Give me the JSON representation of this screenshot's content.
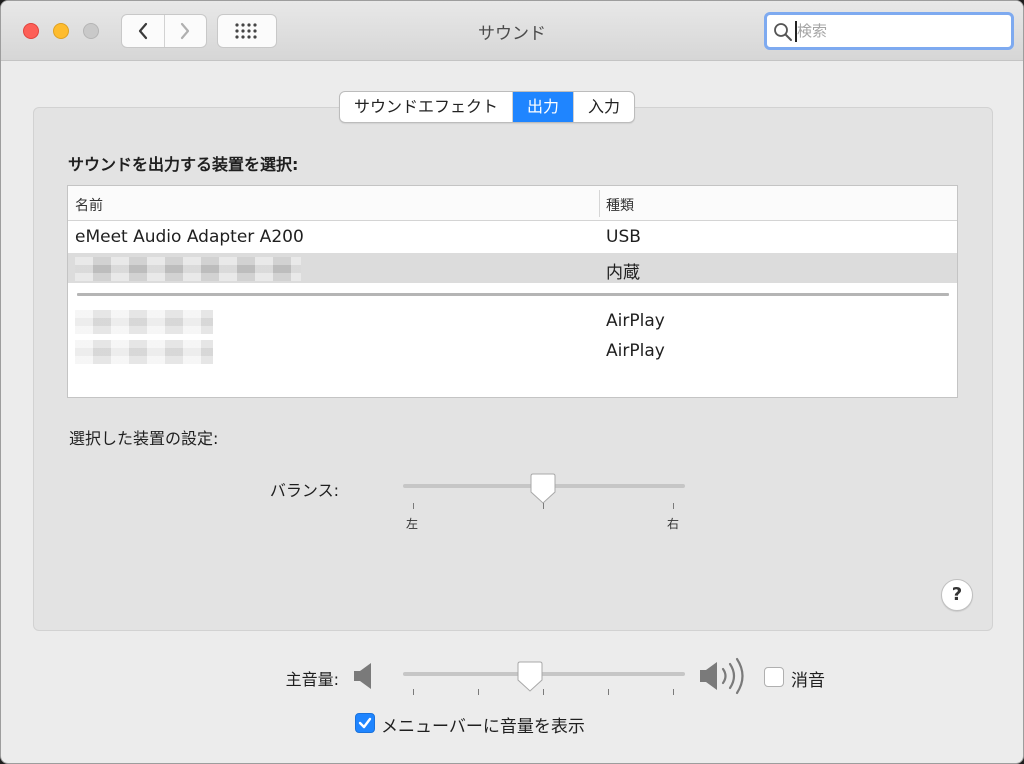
{
  "window": {
    "title": "サウンド"
  },
  "search": {
    "placeholder": "検索",
    "value": ""
  },
  "tabs": [
    {
      "label": "サウンドエフェクト",
      "active": false
    },
    {
      "label": "出力",
      "active": true
    },
    {
      "label": "入力",
      "active": false
    }
  ],
  "output": {
    "section_title": "サウンドを出力する装置を選択:",
    "columns": {
      "name": "名前",
      "type": "種類"
    },
    "devices": [
      {
        "name": "eMeet Audio Adapter A200",
        "type": "USB",
        "selected": false
      },
      {
        "name": "",
        "type": "内蔵",
        "selected": true,
        "name_redacted": true
      },
      {
        "name": "",
        "type": "AirPlay",
        "selected": false,
        "name_redacted": true
      },
      {
        "name": "",
        "type": "AirPlay",
        "selected": false,
        "name_redacted": true
      }
    ],
    "settings_title": "選択した装置の設定:",
    "balance": {
      "label": "バランス:",
      "left_label": "左",
      "right_label": "右",
      "value": 0.5
    },
    "help_label": "?"
  },
  "footer": {
    "volume": {
      "label": "主音量:",
      "value": 0.45
    },
    "mute": {
      "label": "消音",
      "checked": false
    },
    "menubar": {
      "label": "メニューバーに音量を表示",
      "checked": true
    }
  },
  "colors": {
    "accent": "#1f85ff",
    "selected_row": "#dcdcdc"
  }
}
